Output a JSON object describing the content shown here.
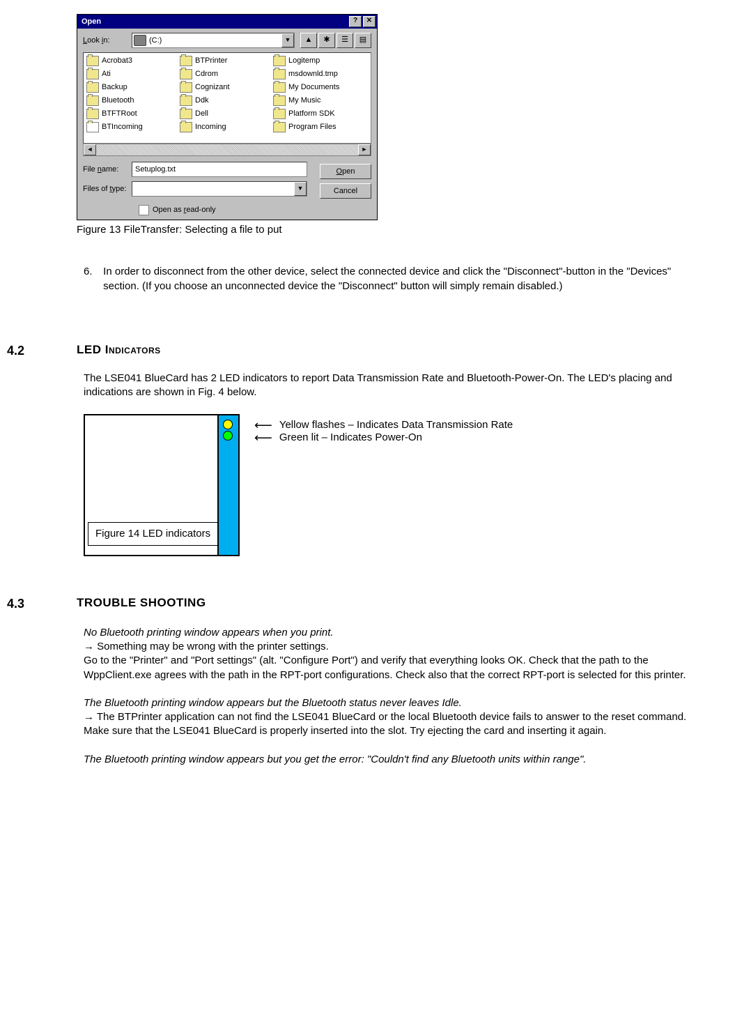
{
  "dialog": {
    "title": "Open",
    "help_btn": "?",
    "close_btn": "✕",
    "lookin_label": "Look in:",
    "lookin_value": "(C:)",
    "toolbar_icons": [
      "up-icon",
      "new-folder-icon",
      "list-icon",
      "details-icon"
    ],
    "files_col1": [
      "Acrobat3",
      "Ati",
      "Backup",
      "Bluetooth",
      "BTFTRoot",
      "BTIncoming"
    ],
    "files_col2": [
      "BTPrinter",
      "Cdrom",
      "Cognizant",
      "Ddk",
      "Dell",
      "Incoming"
    ],
    "files_col3": [
      "Logitemp",
      "msdownld.tmp",
      "My Documents",
      "My Music",
      "Platform SDK",
      "Program Files"
    ],
    "filename_label": "File name:",
    "filename_value": "Setuplog.txt",
    "filetype_label": "Files of type:",
    "filetype_value": "",
    "open_btn": "Open",
    "cancel_btn": "Cancel",
    "readonly_label": "Open as read-only"
  },
  "caption13": "Figure 13 FileTransfer: Selecting a file to put",
  "step6": "In order to disconnect from the other device, select the connected  device and click the \"Disconnect\"-button in the \"Devices\" section. (If you choose an unconnected  device the \"Disconnect\" button will simply remain disabled.)",
  "sec42_num": "4.2",
  "sec42_title": "LED Indicators",
  "sec42_para": "The LSE041 BlueCard has 2 LED indicators to report Data Transmission Rate and Bluetooth-Power-On. The LED's placing and indications are shown in Fig. 4 below.",
  "led_yellow_label": "Yellow flashes – Indicates Data Transmission Rate",
  "led_green_label": "Green lit – Indicates Power-On",
  "caption14": "Figure 14 LED indicators",
  "sec43_num": "4.3",
  "sec43_title": "TROUBLE SHOOTING",
  "ts1_title": "No Bluetooth printing window appears when you print.",
  "ts1_arrow": " → Something may be wrong with the printer settings.",
  "ts1_body": "Go to the \"Printer\" and \"Port settings\" (alt. \"Configure Port\") and verify that everything looks OK. Check that the path to the WppClient.exe agrees with the path in the RPT-port configurations. Check also that the correct RPT-port is selected for this printer.",
  "ts2_title": "The Bluetooth printing window appears but the Bluetooth status never leaves Idle.",
  "ts2_arrow": "→ The BTPrinter application can not find the LSE041 BlueCard or the local Bluetooth device fails to answer to the reset command.",
  "ts2_body": "Make sure that the LSE041 BlueCard is properly inserted into the slot. Try ejecting the card and inserting it again.",
  "ts3_title": "The Bluetooth printing window appears but you get the error: \"Couldn't find any Bluetooth units within range\"."
}
